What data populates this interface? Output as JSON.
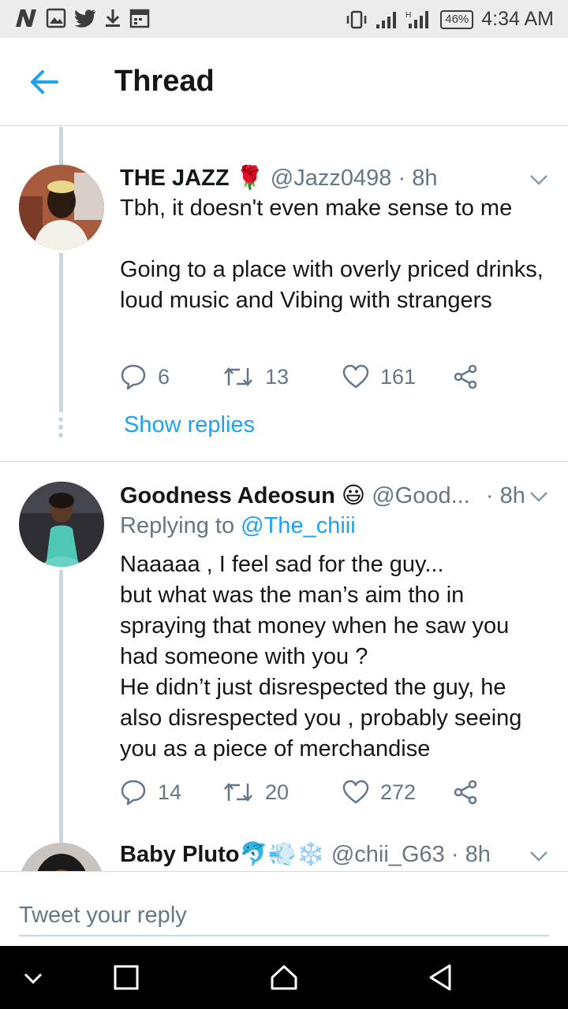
{
  "status_bar": {
    "left_icons": [
      "n-icon",
      "image-icon",
      "twitter-icon",
      "download-icon",
      "calendar-icon"
    ],
    "battery": "46%",
    "time": "4:34 AM"
  },
  "header": {
    "title": "Thread"
  },
  "tweets": [
    {
      "name": "THE JAZZ",
      "emoji": "🌹",
      "handle": "@Jazz0498",
      "time": "8h",
      "text": "Tbh, it doesn't even make sense to me\n\nGoing to a place with overly priced drinks, loud music and Vibing with strangers",
      "replies": "6",
      "retweets": "13",
      "likes": "161",
      "show_replies": "Show replies"
    },
    {
      "name": "Goodness Adeosun",
      "emoji": "😃",
      "handle": "@Good...",
      "time": "8h",
      "replying_prefix": "Replying to",
      "replying_to": "@The_chiii",
      "text": "Naaaaa , I feel sad for the guy...\nbut what was the man’s aim tho in spraying that money when he saw you had someone with you ?\nHe didn’t just disrespected the guy, he also disrespected you , probably seeing you as a piece of merchandise",
      "replies": "14",
      "retweets": "20",
      "likes": "272"
    },
    {
      "name": "Baby Pluto",
      "emoji": "🐬💨❄️",
      "handle": "@chii_G63",
      "time": "8h"
    }
  ],
  "reply_box": {
    "placeholder": "Tweet your reply"
  },
  "colors": {
    "accent": "#1da1f2",
    "secondary_text": "#657786",
    "thread_line": "#ccd6dd"
  }
}
